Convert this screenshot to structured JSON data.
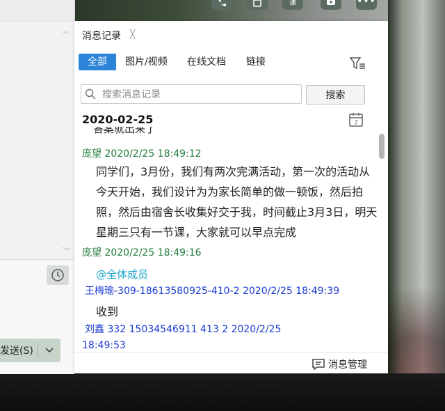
{
  "left_pane": {
    "send_label": "发送(S)"
  },
  "top_icons": {
    "icons": [
      "phone-icon",
      "video-call-icon",
      "lesson-icon",
      "chat-plus-icon",
      "more-icon"
    ],
    "lesson_label": "课"
  },
  "panel": {
    "title": "消息记录",
    "tabs": [
      "全部",
      "图片/视频",
      "在线文档",
      "链接"
    ],
    "search": {
      "placeholder": "搜索消息记录",
      "button_label": "搜索"
    },
    "date_header": "2020-02-25",
    "clipped_line": "答案就出来了",
    "messages": [
      {
        "meta": "庞望 2020/2/25 18:49:12",
        "text": "同学们，3月份，我们有两次完满活动，第一次的活动从今天开始，我们设计为为家长简单的做一顿饭，然后拍照，然后由宿舍长收集好交于我，时间截止3月3日，明天星期三只有一节课，大家就可以早点完成"
      },
      {
        "meta": "庞望 2020/2/25 18:49:16",
        "text": "@全体成员"
      },
      {
        "meta": "王梅瑜-309-18613580925-410-2 2020/2/25 18:49:39",
        "text": "收到"
      },
      {
        "meta_line1": "刘鑫     332      15034546911    413   2 2020/2/25",
        "meta_line2": "18:49:53"
      }
    ],
    "footer": {
      "manage_label": "消息管理"
    }
  },
  "colors": {
    "accent": "#2b84d8",
    "sender_green": "#1f7a3a",
    "sender_blue": "#1a3ad1",
    "mention": "#1aa3c9"
  }
}
